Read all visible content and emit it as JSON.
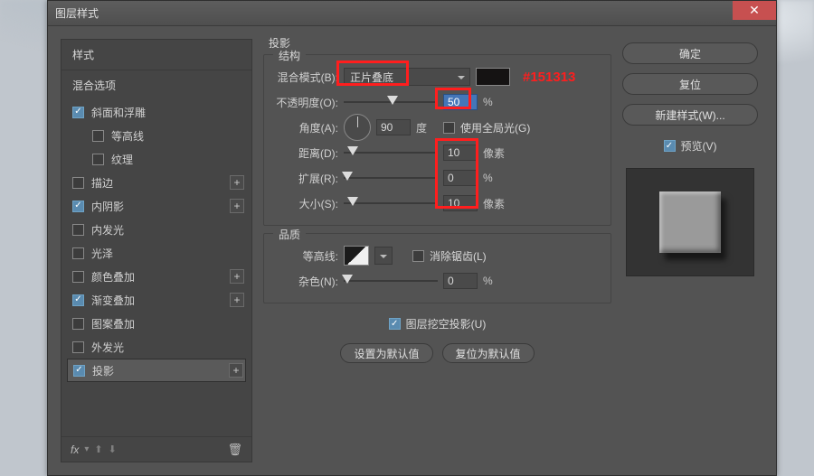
{
  "window": {
    "title": "图层样式"
  },
  "annotation": {
    "color_hex": "#151313"
  },
  "left": {
    "header1": "样式",
    "header2": "混合选项",
    "items": [
      {
        "label": "斜面和浮雕",
        "checked": true,
        "plus": false,
        "sub": false
      },
      {
        "label": "等高线",
        "checked": false,
        "plus": false,
        "sub": true
      },
      {
        "label": "纹理",
        "checked": false,
        "plus": false,
        "sub": true
      },
      {
        "label": "描边",
        "checked": false,
        "plus": true,
        "sub": false
      },
      {
        "label": "内阴影",
        "checked": true,
        "plus": true,
        "sub": false
      },
      {
        "label": "内发光",
        "checked": false,
        "plus": false,
        "sub": false
      },
      {
        "label": "光泽",
        "checked": false,
        "plus": false,
        "sub": false
      },
      {
        "label": "颜色叠加",
        "checked": false,
        "plus": true,
        "sub": false
      },
      {
        "label": "渐变叠加",
        "checked": true,
        "plus": true,
        "sub": false
      },
      {
        "label": "图案叠加",
        "checked": false,
        "plus": false,
        "sub": false
      },
      {
        "label": "外发光",
        "checked": false,
        "plus": false,
        "sub": false
      },
      {
        "label": "投影",
        "checked": true,
        "plus": true,
        "sub": false,
        "selected": true
      }
    ],
    "fx_label": "fx"
  },
  "mid": {
    "title": "投影",
    "structure": {
      "legend": "结构",
      "blend_mode_label": "混合模式(B):",
      "blend_mode_value": "正片叠底",
      "opacity_label": "不透明度(O):",
      "opacity_value": "50",
      "opacity_unit": "%",
      "angle_label": "角度(A):",
      "angle_value": "90",
      "angle_unit": "度",
      "global_light_label": "使用全局光(G)",
      "global_light_checked": false,
      "distance_label": "距离(D):",
      "distance_value": "10",
      "distance_unit": "像素",
      "spread_label": "扩展(R):",
      "spread_value": "0",
      "spread_unit": "%",
      "size_label": "大小(S):",
      "size_value": "10",
      "size_unit": "像素"
    },
    "quality": {
      "legend": "品质",
      "contour_label": "等高线:",
      "antialias_label": "消除锯齿(L)",
      "antialias_checked": false,
      "noise_label": "杂色(N):",
      "noise_value": "0",
      "noise_unit": "%"
    },
    "knockout_label": "图层挖空投影(U)",
    "knockout_checked": true,
    "default_btn": "设置为默认值",
    "reset_btn": "复位为默认值"
  },
  "right": {
    "ok": "确定",
    "cancel": "复位",
    "newstyle": "新建样式(W)...",
    "preview_label": "预览(V)",
    "preview_checked": true
  }
}
